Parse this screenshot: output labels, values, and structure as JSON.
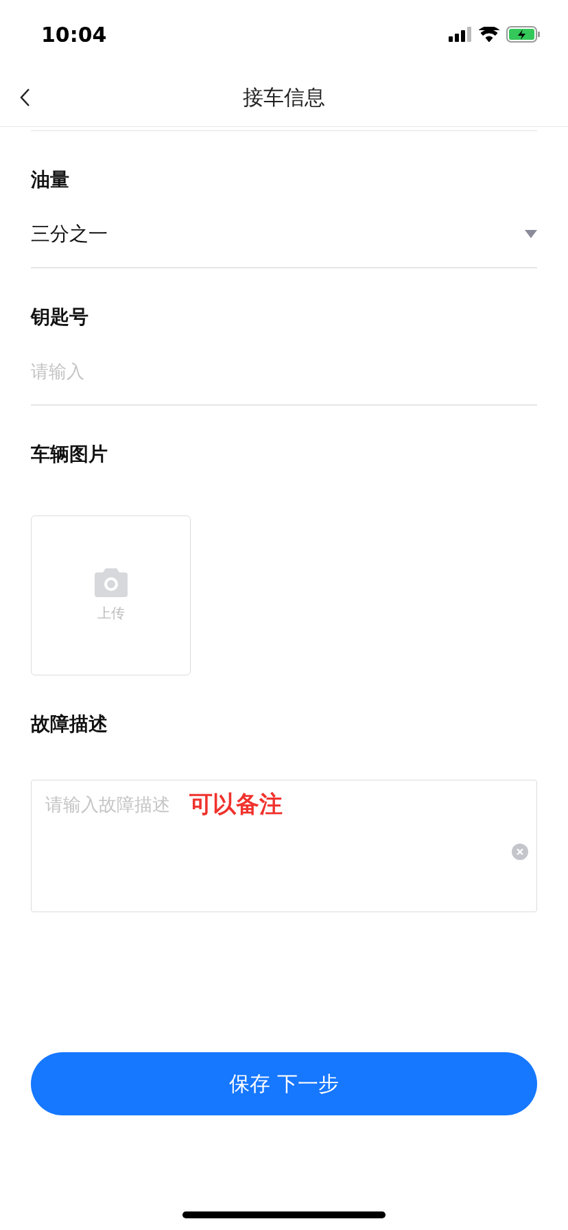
{
  "status_bar": {
    "time": "10:04"
  },
  "nav": {
    "title": "接车信息"
  },
  "fields": [
    {
      "kind": "select",
      "label": "油量",
      "value": "三分之一"
    },
    {
      "kind": "input",
      "label": "钥匙号",
      "placeholder": "请输入"
    },
    {
      "kind": "upload",
      "label": "车辆图片",
      "upload_label": "上传"
    },
    {
      "kind": "textarea",
      "label": "故障描述",
      "placeholder": "请输入故障描述",
      "note": "可以备注"
    }
  ],
  "primary_button": "保存 下一步"
}
